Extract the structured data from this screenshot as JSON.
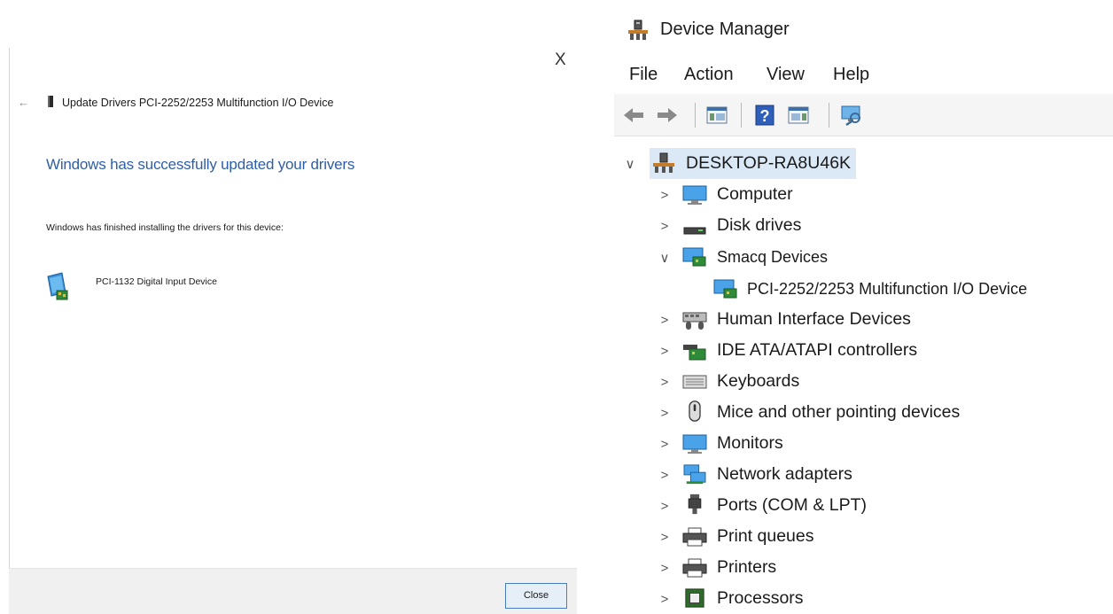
{
  "dialog": {
    "close_x": "X",
    "back_arrow": "←",
    "title": "Update Drivers PCI-2252/2253 Multifunction I/O Device",
    "heading": "Windows has successfully updated your drivers",
    "message": "Windows has finished installing the drivers for this device:",
    "device_name": "PCI-1132 Digital Input Device",
    "close_button": "Close"
  },
  "device_manager": {
    "window_title": "Device Manager",
    "menu": [
      "File",
      "Action",
      "View",
      "Help"
    ],
    "toolbar_icons": [
      "back-arrow-icon",
      "forward-arrow-icon",
      "show-hide-console-tree-icon",
      "help-icon",
      "properties-icon",
      "scan-hardware-icon"
    ],
    "tree": {
      "root": {
        "label": "DESKTOP-RA8U46K",
        "chevron": "∨",
        "icon": "computer-tower-icon",
        "selected": true
      },
      "nodes": [
        {
          "label": "Computer",
          "chevron": ">",
          "icon": "monitor-icon"
        },
        {
          "label": "Disk drives",
          "chevron": ">",
          "icon": "disk-drive-icon"
        },
        {
          "label": "Smacq Devices",
          "chevron": "∨",
          "icon": "pci-card-icon"
        },
        {
          "label": "PCI-2252/2253 Multifunction I/O Device",
          "chevron": "",
          "icon": "pci-card-icon",
          "child": true
        },
        {
          "label": "Human Interface Devices",
          "chevron": ">",
          "icon": "hid-icon"
        },
        {
          "label": "IDE ATA/ATAPI controllers",
          "chevron": ">",
          "icon": "ide-controller-icon"
        },
        {
          "label": "Keyboards",
          "chevron": ">",
          "icon": "keyboard-icon"
        },
        {
          "label": "Mice and other pointing devices",
          "chevron": ">",
          "icon": "mouse-icon"
        },
        {
          "label": "Monitors",
          "chevron": ">",
          "icon": "monitor-icon"
        },
        {
          "label": "Network adapters",
          "chevron": ">",
          "icon": "network-adapter-icon"
        },
        {
          "label": "Ports (COM & LPT)",
          "chevron": ">",
          "icon": "port-icon"
        },
        {
          "label": "Print queues",
          "chevron": ">",
          "icon": "printer-icon"
        },
        {
          "label": "Printers",
          "chevron": ">",
          "icon": "printer-icon"
        },
        {
          "label": "Processors",
          "chevron": ">",
          "icon": "processor-icon"
        }
      ]
    }
  },
  "colors": {
    "heading_blue": "#2f5ea8",
    "selection": "#dbe9f7",
    "button_border": "#4a7cc0"
  }
}
